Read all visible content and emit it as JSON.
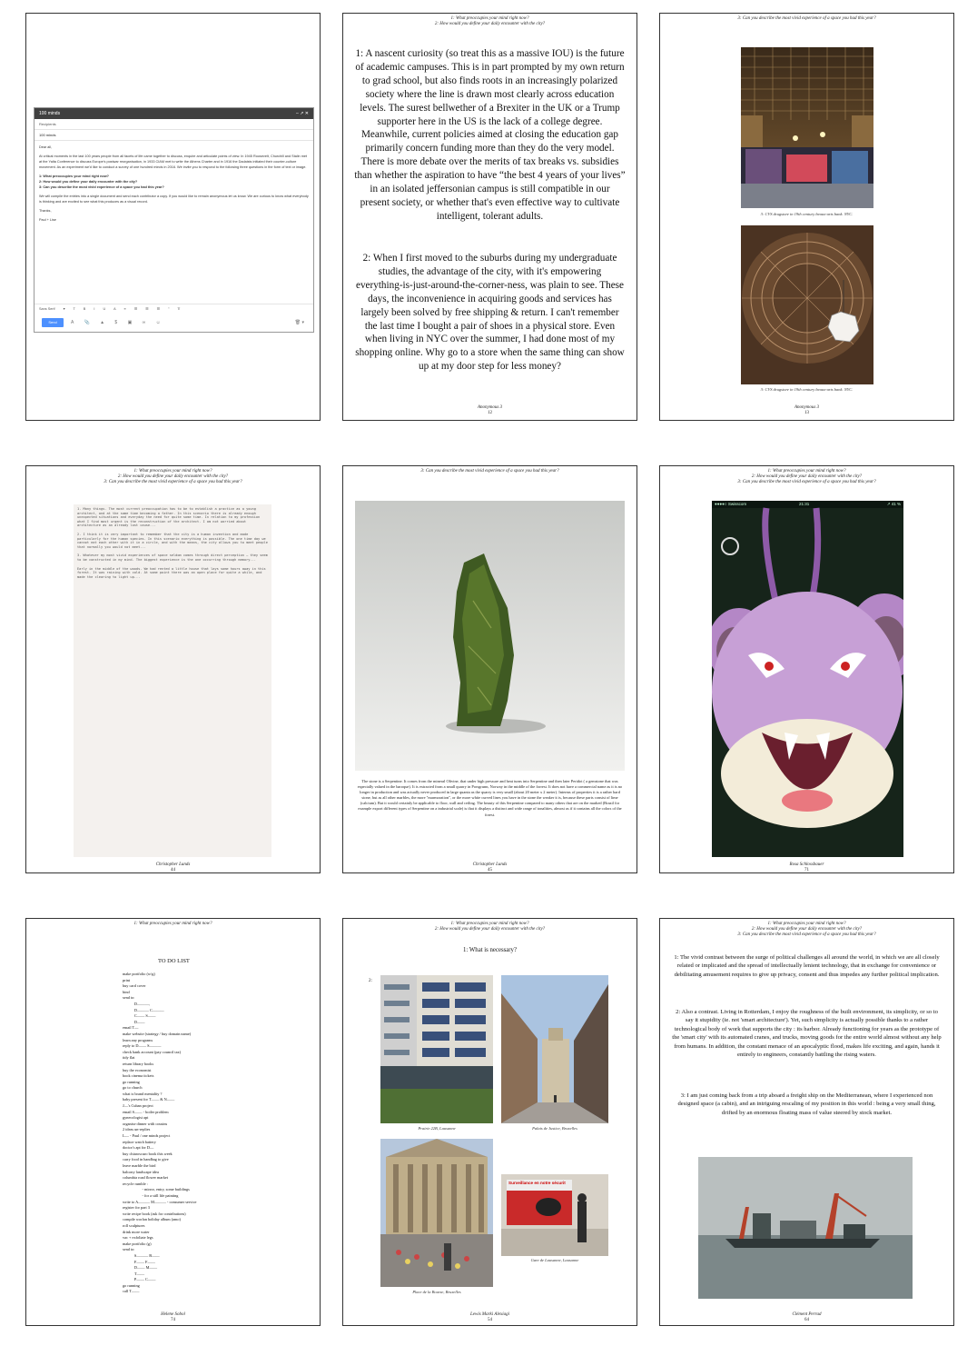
{
  "headers": {
    "q1": "1: What preoccupies your mind right now?",
    "q2": "2: How would you define your daily encounter with the city?",
    "q3": "3: Can you describe the most vivid experience of a space you had this year?"
  },
  "p1": {
    "compose_title": "100 minds",
    "recipients_placeholder": "Recipients",
    "subject": "100 minds",
    "body": [
      "Dear all,",
      "At critical moments in the last 100 years people from all facets of life came together to discuss, enquire and articulate points of view. In 1945 Roosevelt, Churchill and Stalin met at the Yalta Conference to discuss Europe's postwar reorganisation, in 1933 CIAM met to write the Athens Charter and in 1916 the Dadaists initiated their counter-culture movement. As an experiment we'd like to conduct a survey of one hundred minds in 2016. We invite you to respond to the following three questions in the form of text or image.",
      "1: What preoccupies your mind right now?\n2: How would you define your daily encounter with the city?\n3: Can you describe the most vivid experience of a space you had this year?",
      "We will compile the entries into a single document and send each contributor a copy. If you would like to remain anonymous let us know. We are curious to know what everybody is thinking and are excited to see what this produces as a visual record.",
      "Thanks,",
      "Paul + Lise"
    ],
    "font_label": "Sans Serif",
    "send_label": "Send"
  },
  "p2": {
    "para1": "1: A nascent curiosity (so treat this as a massive IOU) is the future of academic campuses. This is in part prompted by my own return to grad school, but also finds roots in an increasingly polarized society where the line is drawn most clearly across education levels. The surest bellwether of a Brexiter in the UK or a Trump supporter here in the US is the lack of a college degree. Meanwhile, current policies aimed at closing the education gap primarily concern funding more than they do the very model. There is more debate over the merits of tax breaks vs. subsidies than whether the aspiration to have “the best 4 years of your lives” in an isolated jeffersonian campus is still compatible in our present society, or whether that's even effective way to cultivate intelligent, tolerant adults.",
    "para2": "2: When I first moved to the suburbs during my undergraduate studies, the advantage of the city, with it's empowering everything-is-just-around-the-corner-ness, was plain to see. These days, the inconvenience in acquiring goods and services has largely been solved by free shipping & return. I can't remember the last time I bought a pair of shoes in a physical store. Even when living in NYC over the summer, I had done most of my shopping online. Why go to a store when the same thing can show up at my door step for less money?",
    "author": "Anonymous 3",
    "page": "12"
  },
  "p3": {
    "caption1": "3: CVS drugstore in 19th century beaux-arts bank. NYC.",
    "caption2": "3: CVS drugstore in 19th century beaux-arts bank. NYC.",
    "author": "Anonymous 3",
    "page": "13"
  },
  "p4": {
    "typed": [
      "1. Many things. The most current preoccupation has to be to establish a practice as a young architect, and at the same time becoming a father. In this scenario there is already enough unexpected situations and everyday the need for quite some time. In relation to my profession what I find most urgent is the reconstruction of the architect. I am not worried about architecture as an already lost cause...",
      "2. I think it is very important to remember that the city is a human invention and made particularly for the human species. In this scenario everything is possible. The one time day we cannot eat each other with it in a circle, and with the means, the city allows you to meet people that normally you would not meet...",
      "3. Whatever my most vivid experiences of space seldom comes through direct perception – they seem to be constructed in my mind. The biggest experience is the one occurring through memory...",
      "Early in the middle of the woods. We had rented a little house that lays some hours away in this forest. It was raining with cold. At some point there was an open place for quite a while, and made the clearing to light up..."
    ],
    "author": "Christopher Lunds",
    "page": "44"
  },
  "p5": {
    "text": "The stone is a Serpentine. It comes from the mineral Olivine, that under high pressure and heat turns into Serpentine and then later Peridot ( a gemstone that was especially valued in the baroque). It is extracted from a small quarry in Porsgrunn, Norway in the middle of the forrest. It does not have a commercial name as it is no longer in production and was actually never produced in large quanta as the quarry is very small (about 20 meter x 2 meter). Interms of properties it is a rather hard stone, but as all other marbles, the more \"marmoration\", or the more white curved lines you have in the stone the weaker it is, because these parts consist of lime (calcium). But it would certainly be applicable to floor, wall and ceiling. The beauty of this Serpentine compared to many others that are on the marked (Brazil for example export different types of Serpentine on a industrial scale) is that it displays a distinct and wide range of tonalities, almost as if it contains all the colors of the forest.",
    "author": "Christopher Lunds",
    "page": "45"
  },
  "p6": {
    "status_left": "●●●●○ Swisscom",
    "status_time": "21:31",
    "status_right": "↗ 41 %",
    "author": "Rosa Schlossbauer",
    "page": "71"
  },
  "p7": {
    "title": "TO DO LIST",
    "items": [
      "make portfolio (w/g)",
      "print",
      "buy card cover",
      "bind",
      "send to:",
      "            D———,",
      "            D——— C———",
      "            C—— S——",
      "            D——",
      "email T—",
      "make website (strategy / buy domain name)",
      "learn any programs",
      "reply to D—— S———",
      "check bank account (pay council tax)",
      "tidy flat",
      "return library books",
      "buy the economist",
      "book cinema tickets",
      "go running",
      "go to church",
      "what is brand mentality ?",
      "baby present for T—— & N——",
      "J—'s Cuban project",
      "email S—— - boiler problem",
      "gynecologist apt",
      "organise dinner with cousins",
      "2 ideas un-replies",
      "L— - Paul / one minds project",
      "replace watch battery",
      "doctor's apt for D—",
      "buy chiaroscuro book this week",
      "carry food in handbag to give",
      "leave marble the bird",
      "balcony landscape idea",
      "columbia road flower market",
      "recycle rumble :",
      "                    - mirror, entry, some buildings",
      "                    - for a still life painting",
      "write to A——— M——— - consumer service",
      "register for part 3",
      "write recipe book (ask for contributions)",
      "compile worlan holiday album (amo)",
      "roll sculptures",
      "drink more water",
      "vac + exfoliate legs",
      "make portfolio (g)",
      "send to:",
      "            S——— B——",
      "            F—— F——",
      "            D—— M——",
      "            T——",
      "            P—— C——",
      "go running",
      "call T——"
    ],
    "author": "Helene Sobol",
    "page": "74"
  },
  "p8": {
    "title": "1: What is necessary?",
    "label2": "2:",
    "cap1": "Prairie 22B, Lausanne",
    "cap2": "Palais de Justice, Bruxelles",
    "cap3": "Place de la Bourse, Bruxelles",
    "cap4": "Gare de Lausanne, Lausanne",
    "poster_text": "Surveillance en notre sécurit",
    "author": "Lewis Marki Alexiagi",
    "page": "54"
  },
  "p9": {
    "para1": "1: The vivid contrast between the surge of political challenges all around the world, in which we are all closely related or implicated and the spread of intellectually lenient technology, that in exchange for convenience or debilitating amusement requires to give up privacy, consent and thus impedes any further political implication.",
    "para2": "2: Also a contrast. Living in Rotterdam, I enjoy the roughness of the built environment, its simplicity, or so to say it stupidity (ie. not 'smart architecture'). Yet, such simplicity is actually possible thanks to a rather technological body of work that supports the city : its harbor. Already functioning for years as the prototype of the 'smart city' with its automated cranes, and trucks, moving goods for the entire world almost without any help from humans. In addition, the constant menace of an apocalyptic flood, makes life exciting, and again, hands it entirely to engineers, constantly battling the rising waters.",
    "para3": "3: I am just coming back from a trip aboard a freight ship on the Mediterranean, where I experienced non designed space (a cabin), and an intriguing rescaling of my position in this world : being a very small thing, drifted by an enormous floating mass of value steered by stock market.",
    "author": "Clément Perrad",
    "page": "64"
  },
  "colors": {
    "border": "#333333",
    "gmail_bar": "#404040",
    "send_blue": "#4d90fe"
  }
}
